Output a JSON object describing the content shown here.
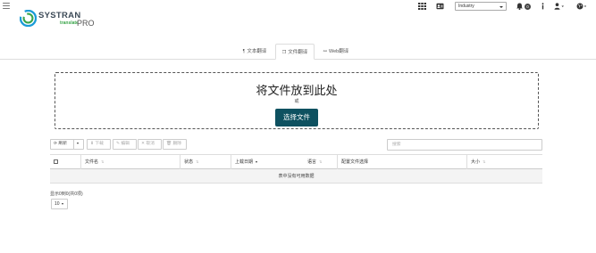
{
  "brand": {
    "name": "SYSTRAN",
    "sub": "translate",
    "tier": "PRO"
  },
  "topbar": {
    "domain_select": "Industry",
    "notification_count": "0",
    "icons": [
      "apps-grid-icon",
      "id-card-icon",
      "bell-icon",
      "info-icon",
      "user-icon",
      "globe-icon"
    ]
  },
  "tabs": [
    {
      "label": "文本翻译",
      "icon": "paragraph-icon",
      "active": false
    },
    {
      "label": "文件翻译",
      "icon": "file-icon",
      "active": true
    },
    {
      "label": "Web翻译",
      "icon": "link-icon",
      "active": false
    }
  ],
  "dropzone": {
    "title": "将文件放到此处",
    "or": "或",
    "button": "选择文件"
  },
  "toolbar": {
    "refresh": "刷新",
    "download": "下载",
    "edit": "编辑",
    "cancel": "取消",
    "delete": "删除",
    "search_placeholder": "搜索"
  },
  "table": {
    "columns": [
      {
        "label": "",
        "sortable": false
      },
      {
        "label": "文件名",
        "sortable": true
      },
      {
        "label": "状态",
        "sortable": true
      },
      {
        "label": "上载日期",
        "sortable": true,
        "sorted": "desc"
      },
      {
        "label": "语言",
        "sortable": true
      },
      {
        "label": "配置文件选择",
        "sortable": false
      },
      {
        "label": "大小",
        "sortable": true
      }
    ],
    "empty_message": "表中没有可用数据"
  },
  "pager": {
    "info": "显示0到0(共0项)",
    "page_size": "10"
  },
  "colors": {
    "primary_button": "#0e5160",
    "logo_green": "#3aa54a"
  }
}
